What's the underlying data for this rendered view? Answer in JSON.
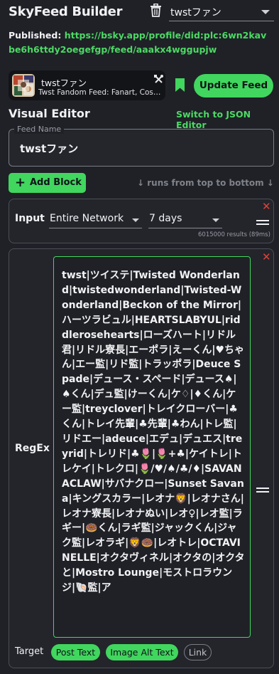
{
  "header": {
    "app_title": "SkyFeed Builder",
    "selected_feed": "twstファン",
    "icons": {
      "delete": "trash-icon",
      "dropdown": "chevron-down-icon"
    }
  },
  "published": {
    "label": "Published:",
    "url": "https://bsky.app/profile/did:plc:6wn2kavbe6h6ttdy2oegefgp/feed/aaakx4wggupjw"
  },
  "feed_card": {
    "title": "twstファン",
    "subtitle": "Twst Fandom Feed: Fanart, Cospla...",
    "icons": {
      "settings": "tools-icon",
      "save": "bookmark-icon"
    }
  },
  "actions": {
    "update_feed": "Update Feed"
  },
  "editor": {
    "title": "Visual Editor",
    "switch_link": "Switch to JSON Editor",
    "feed_name_label": "Feed Name",
    "feed_name_value": "twstファン",
    "add_block": "Add Block",
    "runs_hint": "↓ runs from top to bottom ↓"
  },
  "input_block": {
    "label": "Input",
    "source": "Entire Network",
    "period": "7 days",
    "results": "6015000 results (89ms)"
  },
  "regex_block": {
    "label": "RegEx",
    "pattern": "twst|ツイステ|Twisted Wonderland|twistedwonderland|Twisted-Wonderland|Beckon of the Mirror|ハーツラビュル|HEARTSLABYUL|riddlerosehearts|ローズハート|リドル君|リドル寮長|エーポラ|えーくん|♥ちゃん|エー監|リド監|トラッポラ|Deuce Spade|デュース・スペード|デュース♠|♠くん|デュ監|けーくん|ケ♢|♦くん|ケー監|treyclover|トレイクローバー|♣くん|トレイ先輩|♣先輩|♣わん|トレ監|リドエー|adeuce|エデュ|デュエス|treyrid|トレリド|♣🌷|🌷+♣|ケイトレ|トレケイ|トレクロ|🌷/♥/♠/♣/♦|SAVANACLAW|サバナクロー|Sunset Savana|キングスカラー|レオナ🦁|レオナさん|レオナ寮長|レオナぬい|レオ♀|レオ監|ラギー|🍩くん|ラギ監|ジャックくん|ジャク監|レオラギ|🦁🍩|レオトレ|OCTAVINELLE|オクタヴィネル|オクタの|オクタと|Mostro Lounge|モストロラウンジ|🐚監|ア",
    "target_label": "Target",
    "targets": [
      {
        "label": "Post Text",
        "active": true
      },
      {
        "label": "Image Alt Text",
        "active": true
      },
      {
        "label": "Link",
        "active": false
      }
    ]
  },
  "colors": {
    "accent": "#41d65e",
    "link": "#4cd964",
    "danger": "#e0413b",
    "background": "#1f2127"
  }
}
